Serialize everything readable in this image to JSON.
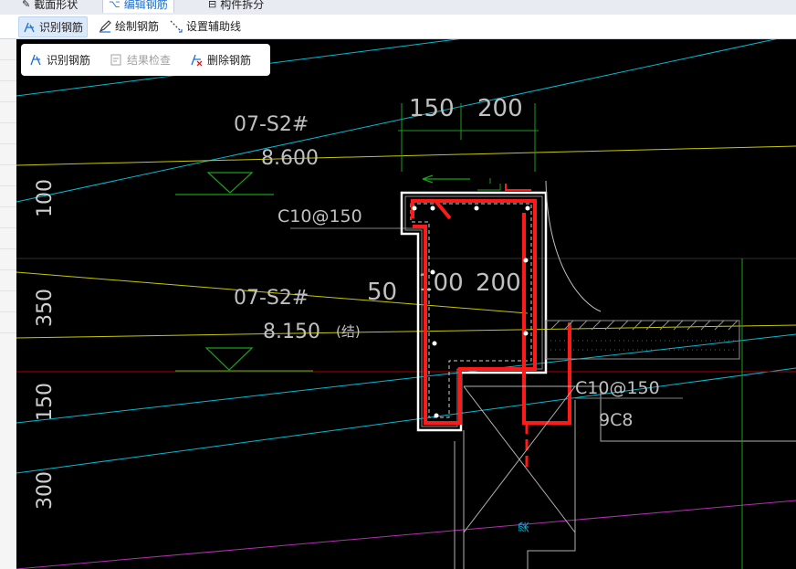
{
  "tabs": [
    {
      "label": "截面形状"
    },
    {
      "label": "编辑钢筋",
      "active": true
    },
    {
      "label": "构件拆分"
    }
  ],
  "toolbar": {
    "identify_label": "识别钢筋",
    "draw_label": "绘制钢筋",
    "aux_label": "设置辅助线"
  },
  "panel": {
    "identify_label": "识别钢筋",
    "check_label": "结果检查",
    "delete_label": "删除钢筋"
  },
  "drawing": {
    "dim_top": [
      "150",
      "200"
    ],
    "dim_mid": [
      "50",
      "100",
      "200"
    ],
    "dim_left": [
      "100",
      "350",
      "150",
      "300"
    ],
    "level1_name": "07-S2#",
    "level1_value": "8.600",
    "level2_name": "07-S2#",
    "level2_value": "8.150",
    "level2_note": "(结)",
    "rebar_label": "C10@150",
    "rebar_right": "C10@150",
    "rebar_bottom": "9C8",
    "tag_small": "梁"
  },
  "colors": {
    "rebar": "#ff1a1a",
    "cyan": "#00bcd4",
    "yellow": "#c8c800",
    "green": "#1aa01a",
    "magenta": "#b030b0",
    "accent": "#1a6fd1"
  }
}
